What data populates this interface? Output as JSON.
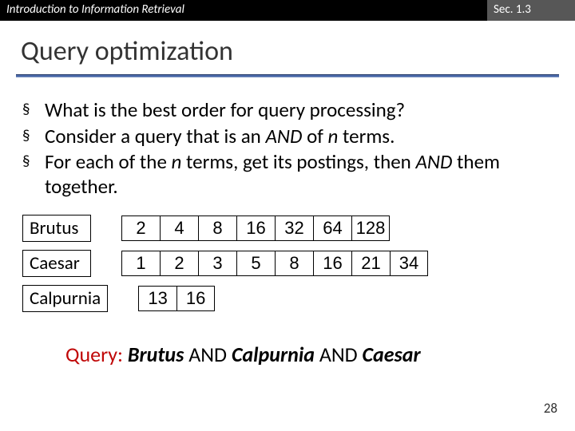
{
  "header": {
    "left": "Introduction to Information Retrieval",
    "right": "Sec. 1.3"
  },
  "title": "Query optimization",
  "bullets": [
    "What is the best order for query processing?",
    "Consider a query that is an AND of n terms.",
    "For each of the n terms, get its postings, then AND them together."
  ],
  "terms": [
    {
      "name": "Brutus",
      "postings": [
        "2",
        "4",
        "8",
        "16",
        "32",
        "64",
        "128"
      ]
    },
    {
      "name": "Caesar",
      "postings": [
        "1",
        "2",
        "3",
        "5",
        "8",
        "16",
        "21",
        "34"
      ]
    },
    {
      "name": "Calpurnia",
      "postings": [
        "13",
        "16"
      ]
    }
  ],
  "query": {
    "prefix": "Query:",
    "a": "Brutus",
    "op": "AND",
    "b": "Calpurnia",
    "c": "Caesar"
  },
  "page": "28"
}
